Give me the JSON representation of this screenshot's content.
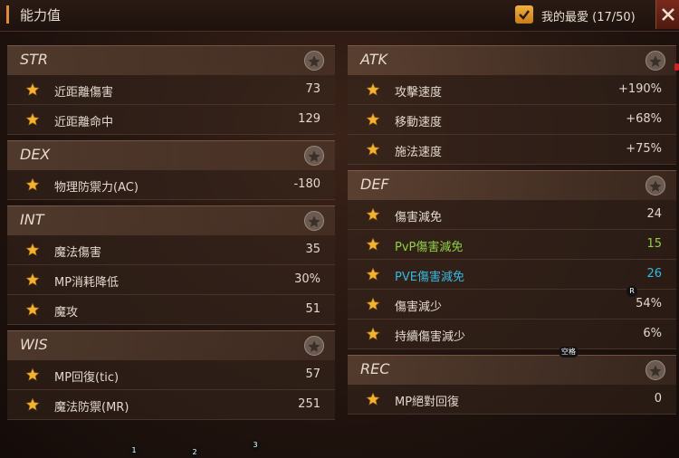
{
  "header": {
    "title": "能力值",
    "favorites_label": "我的最愛 (17/50)"
  },
  "colors": {
    "accent": "#e08a3a",
    "star": "#f2b234",
    "green_text": "#8fd044",
    "cyan_text": "#38b8e0"
  },
  "left": [
    {
      "name": "STR",
      "rows": [
        {
          "label": "近距離傷害",
          "value": "73"
        },
        {
          "label": "近距離命中",
          "value": "129"
        }
      ]
    },
    {
      "name": "DEX",
      "rows": [
        {
          "label": "物理防禦力(AC)",
          "value": "-180"
        }
      ]
    },
    {
      "name": "INT",
      "rows": [
        {
          "label": "魔法傷害",
          "value": "35"
        },
        {
          "label": "MP消耗降低",
          "value": "30%"
        },
        {
          "label": "魔攻",
          "value": "51"
        }
      ]
    },
    {
      "name": "WIS",
      "rows": [
        {
          "label": "MP回復(tic)",
          "value": "57"
        },
        {
          "label": "魔法防禦(MR)",
          "value": "251"
        }
      ]
    }
  ],
  "right": [
    {
      "name": "ATK",
      "rows": [
        {
          "label": "攻擊速度",
          "value": "+190%"
        },
        {
          "label": "移動速度",
          "value": "+68%"
        },
        {
          "label": "施法速度",
          "value": "+75%"
        }
      ]
    },
    {
      "name": "DEF",
      "rows": [
        {
          "label": "傷害減免",
          "value": "24"
        },
        {
          "label": "PvP傷害減免",
          "value": "15",
          "tint": "green"
        },
        {
          "label": "PVE傷害減免",
          "value": "26",
          "tint": "cyan"
        },
        {
          "label": "傷害減少",
          "value": "54%"
        },
        {
          "label": "持續傷害減少",
          "value": "6%"
        }
      ]
    },
    {
      "name": "REC",
      "rows": [
        {
          "label": "MP絕對回復",
          "value": "0"
        }
      ]
    }
  ],
  "overlay_markers": {
    "m1": "1",
    "m2": "2",
    "m3": "3",
    "mr": "R",
    "space": "空格"
  }
}
